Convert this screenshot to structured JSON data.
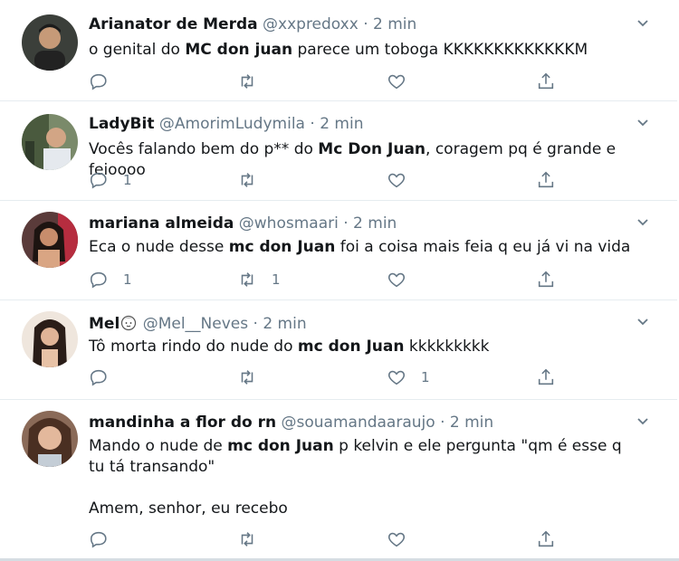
{
  "colors": {
    "text": "#14171a",
    "muted": "#657786",
    "divider": "#e6ecf0"
  },
  "tweets": [
    {
      "name": "Arianator de Merda",
      "handle": "@xxpredoxx",
      "dot": "·",
      "time": "2 min",
      "text": {
        "pre": "o genital do ",
        "bold": "MC don juan",
        "post": " parece um toboga KKKKKKKKKKKKKM"
      },
      "reply_count": "",
      "retweet_count": "",
      "like_count": ""
    },
    {
      "name": "LadyBit",
      "handle": "@AmorimLudymila",
      "dot": "·",
      "time": "2 min",
      "text": {
        "pre": "Vocês falando bem do p** do ",
        "bold": "Mc Don Juan",
        "post": ", coragem pq é grande e feioooo"
      },
      "reply_count": "1",
      "retweet_count": "",
      "like_count": ""
    },
    {
      "name": "mariana almeida",
      "handle": "@whosmaari",
      "dot": "·",
      "time": "2 min",
      "text": {
        "pre": "Eca o nude desse ",
        "bold": "mc don Juan",
        "post": " foi a coisa mais feia q eu já vi na vida"
      },
      "reply_count": "1",
      "retweet_count": "1",
      "like_count": ""
    },
    {
      "name": "Mel",
      "handle": "@Mel__Neves",
      "dot": "·",
      "time": "2 min",
      "text": {
        "pre": "Tô morta rindo do nude do ",
        "bold": "mc don Juan",
        "post": " kkkkkkkkk"
      },
      "reply_count": "",
      "retweet_count": "",
      "like_count": "1"
    },
    {
      "name": "mandinha a flor do rn",
      "handle": "@souamandaaraujo",
      "dot": "·",
      "time": "2 min",
      "text": {
        "pre": "Mando o nude de ",
        "bold": "mc don Juan",
        "post": " p kelvin e ele pergunta \"qm é esse q tu tá transando\"\n\nAmem, senhor, eu recebo"
      },
      "reply_count": "",
      "retweet_count": "",
      "like_count": ""
    }
  ]
}
